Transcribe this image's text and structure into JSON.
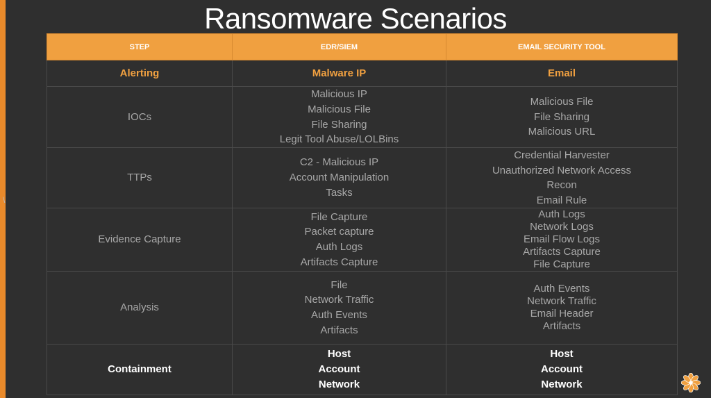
{
  "title": "Ransomware Scenarios",
  "table": {
    "headers": [
      "STEP",
      "EDR/SIEM",
      "EMAIL SECURITY TOOL"
    ],
    "rows": [
      {
        "step": "Alerting",
        "edr": [
          "Malware IP"
        ],
        "email": [
          "Email"
        ]
      },
      {
        "step": "IOCs",
        "edr": [
          "Malicious IP",
          "Malicious File",
          "File Sharing",
          "Legit Tool Abuse/LOLBins"
        ],
        "email": [
          "Malicious File",
          "File Sharing",
          "Malicious URL"
        ]
      },
      {
        "step": "TTPs",
        "edr": [
          "C2 - Malicious IP",
          "Account Manipulation",
          "Tasks"
        ],
        "email": [
          "Credential Harvester",
          "Unauthorized Network Access",
          "Recon",
          "Email Rule"
        ]
      },
      {
        "step": "Evidence Capture",
        "edr": [
          "File Capture",
          "Packet capture",
          "Auth Logs",
          "Artifacts Capture"
        ],
        "email": [
          "Auth Logs",
          "Network Logs",
          "Email Flow Logs",
          "Artifacts Capture",
          "File Capture"
        ]
      },
      {
        "step": "Analysis",
        "edr": [
          "File",
          "Network Traffic",
          "Auth Events",
          "Artifacts"
        ],
        "email": [
          "Auth Events",
          "Network Traffic",
          "Email Header",
          "Artifacts"
        ]
      },
      {
        "step": "Containment",
        "edr": [
          "Host",
          "Account",
          "Network"
        ],
        "email": [
          "Host",
          "Account",
          "Network"
        ]
      }
    ]
  },
  "stray_mark": "\\",
  "colors": {
    "accent": "#f0a040",
    "background": "#2f2f2f",
    "text_muted": "#a8a8a8"
  },
  "logo_icon": "orange-flower-logo-icon"
}
